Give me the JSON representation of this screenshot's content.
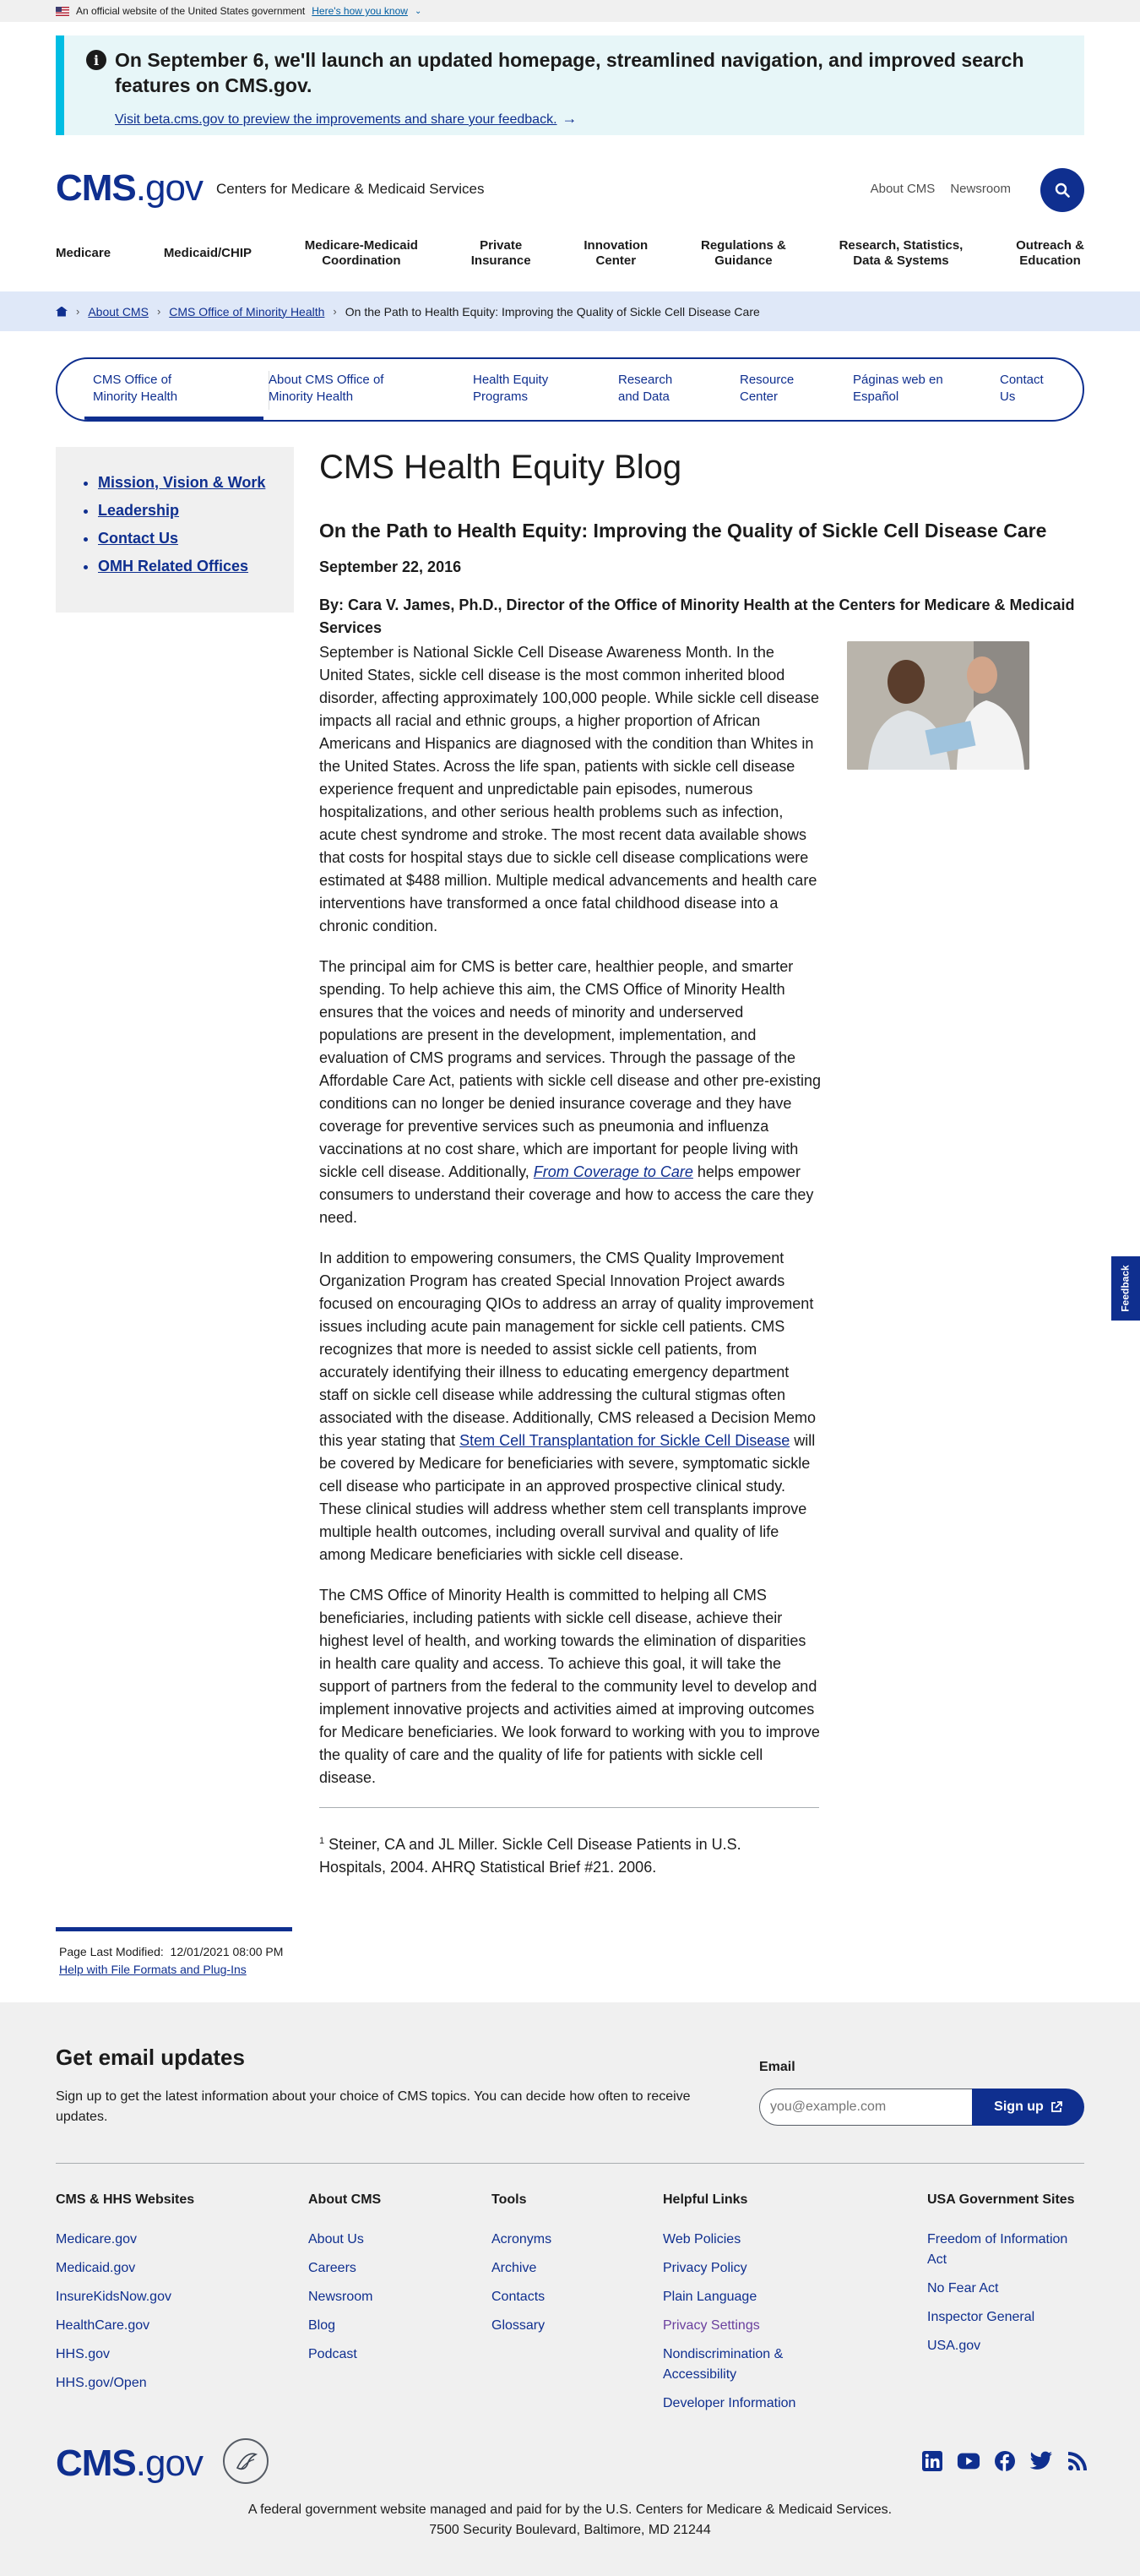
{
  "gov_banner": {
    "text": "An official website of the United States government",
    "link": "Here's how you know"
  },
  "alert": {
    "heading": "On September 6, we'll launch an updated homepage, streamlined navigation, and improved search features on CMS.gov.",
    "link": "Visit beta.cms.gov to preview the improvements and share your feedback."
  },
  "header": {
    "logo_cms": "CMS",
    "logo_gov": ".gov",
    "site_name": "Centers for Medicare & Medicaid Services",
    "util_links": [
      "About CMS",
      "Newsroom"
    ]
  },
  "mainnav": [
    "Medicare",
    "Medicaid/CHIP",
    "Medicare-Medicaid\nCoordination",
    "Private\nInsurance",
    "Innovation\nCenter",
    "Regulations &\nGuidance",
    "Research, Statistics,\nData & Systems",
    "Outreach &\nEducation"
  ],
  "breadcrumb": [
    "About CMS",
    "CMS Office of Minority Health",
    "On the Path to Health Equity: Improving the Quality of Sickle Cell Disease Care"
  ],
  "tabs": [
    "CMS Office of\nMinority Health",
    "About CMS Office of\nMinority Health",
    "Health Equity\nPrograms",
    "Research\nand Data",
    "Resource\nCenter",
    "Páginas web en\nEspañol",
    "Contact\nUs"
  ],
  "sidebar": [
    "Mission, Vision & Work",
    "Leadership",
    "Contact Us",
    "OMH Related Offices"
  ],
  "article": {
    "page_title": "CMS Health Equity Blog",
    "title": "On the Path to Health Equity: Improving the Quality of Sickle Cell Disease Care",
    "date": "September 22, 2016",
    "byline": "By: Cara V. James, Ph.D., Director of the Office of Minority Health at the Centers for Medicare & Medicaid Services",
    "p1": "September is National Sickle Cell Disease Awareness Month. In the United States, sickle cell disease is the most common inherited blood disorder, affecting approximately 100,000 people. While sickle cell disease impacts all racial and ethnic groups, a higher proportion of African Americans and Hispanics are diagnosed with the condition than Whites in the United States. Across the life span, patients with sickle cell disease experience frequent and unpredictable pain episodes, numerous hospitalizations, and other serious health problems such as infection, acute chest syndrome and stroke. The most recent data available shows that costs for hospital stays due to sickle cell disease complications were estimated at $488 million. Multiple medical advancements and health care interventions have transformed a once fatal childhood disease into a chronic condition.",
    "p2_a": "The principal aim for CMS is better care, healthier people, and smarter spending. To help achieve this aim, the CMS Office of Minority Health ensures that the voices and needs of minority and underserved populations are present in the development, implementation, and evaluation of CMS programs and services. Through the passage of the Affordable Care Act, patients with sickle cell disease and other pre-existing conditions can no longer be denied insurance coverage and they have coverage for preventive services such as pneumonia and influenza vaccinations at no cost share, which are important for people living with sickle cell disease. Additionally, ",
    "p2_link": "From Coverage to Care",
    "p2_b": " helps empower consumers to understand their coverage and how to access the care they need.",
    "p3_a": "In addition to empowering consumers, the CMS Quality Improvement Organization Program has created Special Innovation Project awards focused on encouraging QIOs to address an array of quality improvement issues including acute pain management for sickle cell patients. CMS recognizes that more is needed to assist sickle cell patients, from accurately identifying their illness to educating emergency department staff on sickle cell disease while addressing the cultural stigmas often associated with the disease. Additionally, CMS released a Decision Memo this year stating that ",
    "p3_link": "Stem Cell Transplantation for Sickle Cell Disease",
    "p3_b": " will be covered by Medicare for beneficiaries with severe, symptomatic sickle cell disease who participate in an approved prospective clinical study. These clinical studies will address whether stem cell transplants improve multiple health outcomes, including overall survival and quality of life among Medicare beneficiaries with sickle cell disease.",
    "p4": "The CMS Office of Minority Health is committed to helping all CMS beneficiaries, including patients with sickle cell disease, achieve their highest level of health, and working towards the elimination of disparities in health care quality and access. To achieve this goal, it will take the support of partners from the federal to the community level to develop and implement innovative projects and activities aimed at improving outcomes for Medicare beneficiaries. We look forward to working with you to improve the quality of care and the quality of life for patients with sickle cell disease.",
    "footnote_num": "1",
    "footnote": " Steiner, CA and JL Miller. Sickle Cell Disease Patients in U.S. Hospitals, 2004. AHRQ Statistical Brief #21. 2006."
  },
  "lastmod": {
    "label": "Page Last Modified:",
    "value": "12/01/2021 08:00 PM",
    "link": "Help with File Formats and Plug-Ins"
  },
  "feedback": "Feedback",
  "footer": {
    "email_heading": "Get email updates",
    "email_text": "Sign up to get the latest information about your choice of CMS topics. You can decide how often to receive updates.",
    "email_label": "Email",
    "email_placeholder": "you@example.com",
    "signup": "Sign up",
    "columns": [
      {
        "title": "CMS & HHS Websites",
        "links": [
          "Medicare.gov",
          "Medicaid.gov",
          "InsureKidsNow.gov",
          "HealthCare.gov",
          "HHS.gov",
          "HHS.gov/Open"
        ]
      },
      {
        "title": "About CMS",
        "links": [
          "About Us",
          "Careers",
          "Newsroom",
          "Blog",
          "Podcast"
        ]
      },
      {
        "title": "Tools",
        "links": [
          "Acronyms",
          "Archive",
          "Contacts",
          "Glossary"
        ]
      },
      {
        "title": "Helpful Links",
        "links": [
          "Web Policies",
          "Privacy Policy",
          "Plain Language",
          "Privacy Settings",
          "Nondiscrimination & Accessibility",
          "Developer Information"
        ]
      },
      {
        "title": "USA Government Sites",
        "links": [
          "Freedom of Information Act",
          "No Fear Act",
          "Inspector General",
          "USA.gov"
        ]
      }
    ],
    "social_icons": [
      "linkedin-icon",
      "youtube-icon",
      "facebook-icon",
      "twitter-icon",
      "rss-icon"
    ],
    "address_line1": "A federal government website managed and paid for by the U.S. Centers for Medicare & Medicaid Services.",
    "address_line2": "7500 Security Boulevard, Baltimore, MD 21244"
  },
  "colors": {
    "brand": "#0f2f8f",
    "alert_bg": "#e7f6f8",
    "alert_border": "#00bde3",
    "crumb_bg": "#dfe8f8",
    "footer_bg": "#f0f0f0"
  }
}
